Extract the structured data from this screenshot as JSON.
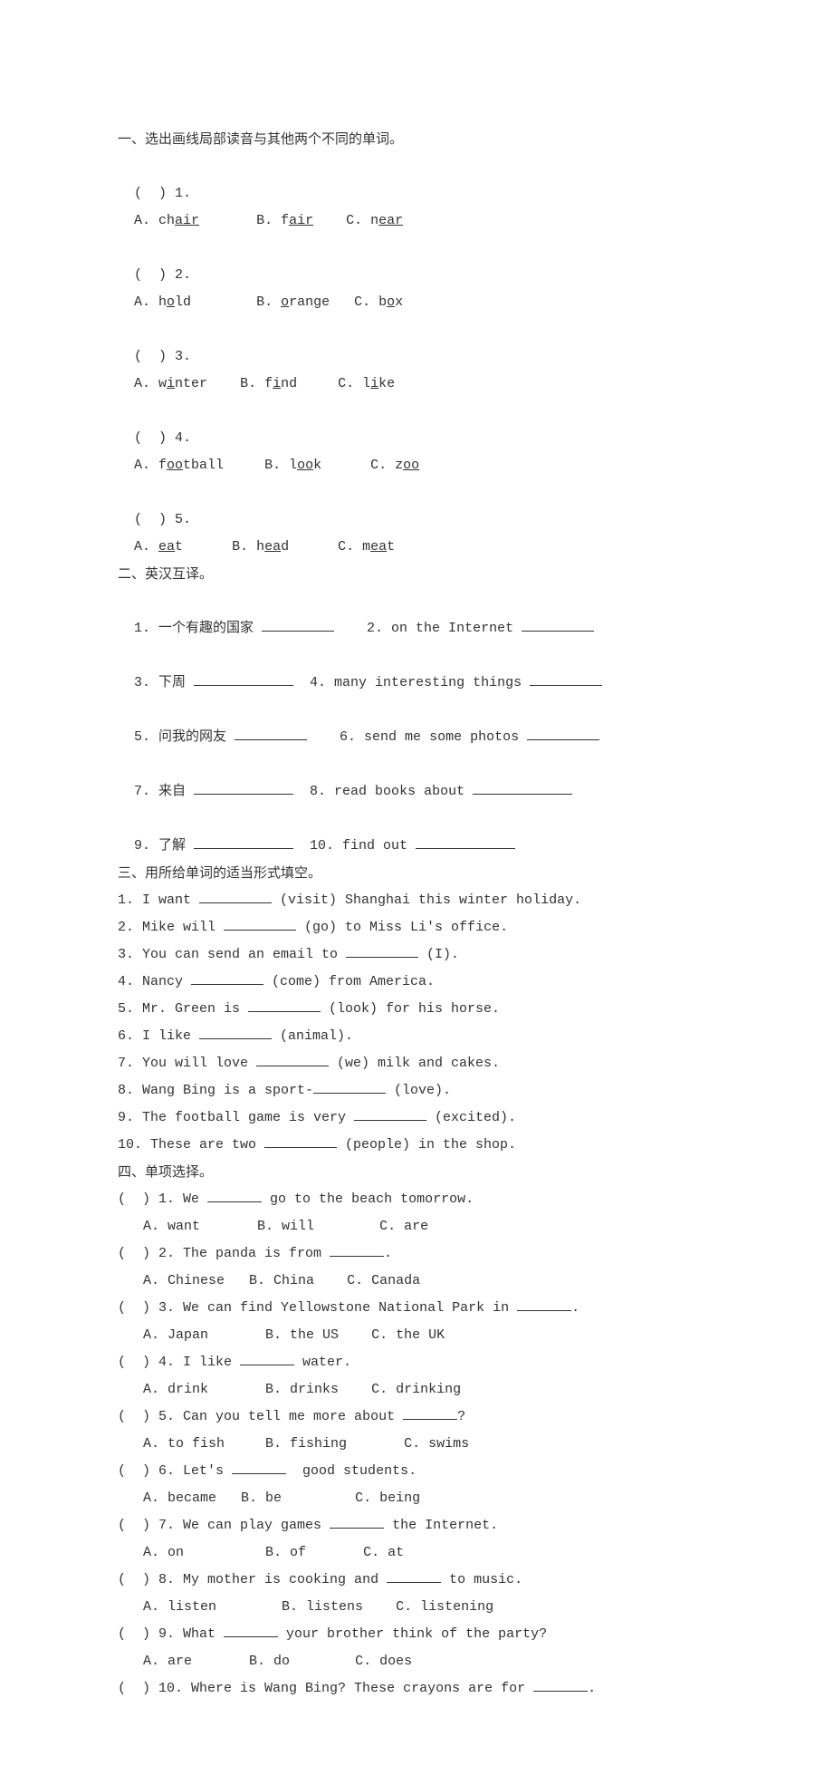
{
  "section1": {
    "title": "一、选出画线局部读音与其他两个不同的单词。",
    "q1": {
      "num": "(  ) 1.",
      "a_pre": "A. ch",
      "a_u": "air",
      "b_pre": "B. f",
      "b_u": "air",
      "c_pre": "C. n",
      "c_u": "ear"
    },
    "q2": {
      "num": "(  ) 2.",
      "a_pre": "A. h",
      "a_u": "o",
      "a_post": "ld",
      "b_pre": "B. ",
      "b_u": "o",
      "b_post": "range",
      "c_pre": "C. b",
      "c_u": "o",
      "c_post": "x"
    },
    "q3": {
      "num": "(  ) 3.",
      "a_pre": "A. w",
      "a_u": "i",
      "a_post": "nter",
      "b_pre": "B. f",
      "b_u": "i",
      "b_post": "nd",
      "c_pre": "C. l",
      "c_u": "i",
      "c_post": "ke"
    },
    "q4": {
      "num": "(  ) 4.",
      "a_pre": "A. f",
      "a_u": "oo",
      "a_post": "tball",
      "b_pre": "B. l",
      "b_u": "oo",
      "b_post": "k",
      "c_pre": "C. z",
      "c_u": "oo"
    },
    "q5": {
      "num": "(  ) 5.",
      "a_pre": "A. ",
      "a_u": "ea",
      "a_post": "t",
      "b_pre": "B. h",
      "b_u": "ea",
      "b_post": "d",
      "c_pre": "C. m",
      "c_u": "ea",
      "c_post": "t"
    }
  },
  "section2": {
    "title": "二、英汉互译。",
    "q1": "1. 一个有趣的国家 ",
    "q2": "2. on the Internet ",
    "q3": "3. 下周 ",
    "q4": "4. many interesting things ",
    "q5": "5. 问我的网友 ",
    "q6": "6. send me some photos ",
    "q7": "7. 来自 ",
    "q8": "8. read books about ",
    "q9": "9. 了解 ",
    "q10": "10. find out "
  },
  "section3": {
    "title": "三、用所给单词的适当形式填空。",
    "q1_a": "1. I want ",
    "q1_b": " (visit) Shanghai this winter holiday.",
    "q2_a": "2. Mike will ",
    "q2_b": " (go) to Miss Li's office.",
    "q3_a": "3. You can send an email to ",
    "q3_b": " (I).",
    "q4_a": "4. Nancy ",
    "q4_b": " (come) from America.",
    "q5_a": "5. Mr. Green is ",
    "q5_b": " (look) for his horse.",
    "q6_a": "6. I like ",
    "q6_b": " (animal).",
    "q7_a": "7. You will love ",
    "q7_b": " (we) milk and cakes.",
    "q8_a": "8. Wang Bing is a sport-",
    "q8_b": " (love).",
    "q9_a": "9. The football game is very ",
    "q9_b": " (excited).",
    "q10_a": "10. These are two ",
    "q10_b": " (people) in the shop."
  },
  "section4": {
    "title": "四、单项选择。",
    "q1": {
      "num": "(  ) 1.",
      "stem_a": "We ",
      "stem_b": " go to the beach tomorrow.",
      "optA": "A. want",
      "optB": "B. will",
      "optC": "C. are"
    },
    "q2": {
      "num": "(  ) 2.",
      "stem_a": "The panda is from ",
      "stem_b": ".",
      "optA": "A. Chinese",
      "optB": "B. China",
      "optC": "C. Canada"
    },
    "q3": {
      "num": "(  ) 3.",
      "stem_a": "We can find Yellowstone National Park in ",
      "stem_b": ".",
      "optA": "A. Japan",
      "optB": "B. the US",
      "optC": "C. the UK"
    },
    "q4": {
      "num": "(  ) 4.",
      "stem_a": "I like ",
      "stem_b": " water.",
      "optA": "A. drink",
      "optB": "B. drinks",
      "optC": "C. drinking"
    },
    "q5": {
      "num": "(  ) 5.",
      "stem_a": "Can you tell me more about ",
      "stem_b": "?",
      "optA": "A. to fish",
      "optB": "B. fishing",
      "optC": "C. swims"
    },
    "q6": {
      "num": "(  ) 6.",
      "stem_a": "Let's ",
      "stem_b": "  good students.",
      "optA": "A. became",
      "optB": "B. be",
      "optC": "C. being"
    },
    "q7": {
      "num": "(  ) 7.",
      "stem_a": "We can play games ",
      "stem_b": " the Internet.",
      "optA": "A. on",
      "optB": "B. of",
      "optC": "C. at"
    },
    "q8": {
      "num": "(  ) 8.",
      "stem_a": "My mother is cooking and ",
      "stem_b": " to music.",
      "optA": "A. listen",
      "optB": "B. listens",
      "optC": "C. listening"
    },
    "q9": {
      "num": "(  ) 9.",
      "stem_a": "What ",
      "stem_b": " your brother think of the party?",
      "optA": "A. are",
      "optB": "B. do",
      "optC": "C. does"
    },
    "q10": {
      "num": "(  ) 10.",
      "stem_a": "Where is Wang Bing? These crayons are for ",
      "stem_b": "."
    }
  }
}
